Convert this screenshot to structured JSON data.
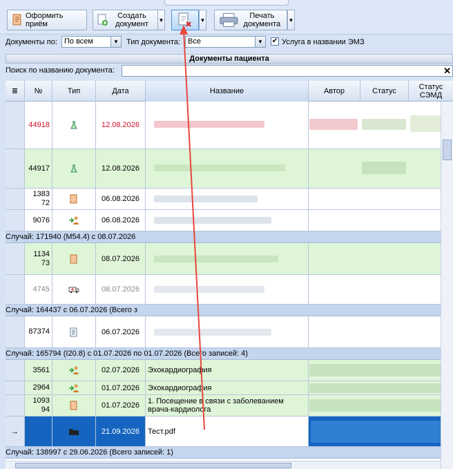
{
  "toolbar": {
    "btn_reception": "Оформить приём",
    "btn_create": "Создать документ",
    "btn_print": "Печать документа"
  },
  "filters": {
    "docs_label": "Документы по:",
    "docs_value": "По всем",
    "type_label": "Тип документа:",
    "type_value": "Все",
    "service_check": "✔",
    "service_label": "Услуга в названии ЭМЗ"
  },
  "section_title": "Документы пациента",
  "search": {
    "label": "Поиск по названию документа:",
    "value": "",
    "clear": "✕"
  },
  "columns": [
    "№",
    "Тип",
    "Дата",
    "Название",
    "Автор",
    "Статус",
    "Статус СЭМД"
  ],
  "menu_glyph": "≣",
  "rows": [
    {
      "num": "44918",
      "date": "12.08.2026",
      "name": ""
    },
    {
      "num": "44917",
      "date": "12.08.2026",
      "name": ""
    },
    {
      "num": "138372",
      "date": "06.08.2026",
      "name": ""
    },
    {
      "num": "9076",
      "date": "06.08.2026",
      "name": ""
    },
    {
      "group": "Случай: 171940 (M54.4) с 08.07.2026"
    },
    {
      "num": "113473",
      "date": "08.07.2026",
      "name": ""
    },
    {
      "num": "4745",
      "date": "08.07.2026",
      "name": ""
    },
    {
      "group": "Случай: 164437 с 06.07.2026  (Всего з"
    },
    {
      "num": "87374",
      "date": "06.07.2026",
      "name": ""
    },
    {
      "group": "Случай: 165794 (I20.8) с 01.07.2026  по 01.07.2026 (Всего записей: 4)"
    },
    {
      "num": "3561",
      "date": "02.07.2026",
      "name": "Эхокардиография"
    },
    {
      "num": "2964",
      "date": "01.07.2026",
      "name": "Эхокардиография"
    },
    {
      "num": "109394",
      "date": "01.07.2026",
      "name": "1. Посещение в связи с заболеванием врача-кардиолога"
    },
    {
      "num": "",
      "date": "21.09.2026",
      "name": "Тест.pdf",
      "current": "→"
    },
    {
      "group": "Случай: 138997 с 29.06.2026  (Всего записей: 1)"
    }
  ],
  "colors": {
    "accent": "#1565c0",
    "green_row": "#dff5d8",
    "red_text": "#d0102a",
    "arrow": "#e8473c"
  }
}
